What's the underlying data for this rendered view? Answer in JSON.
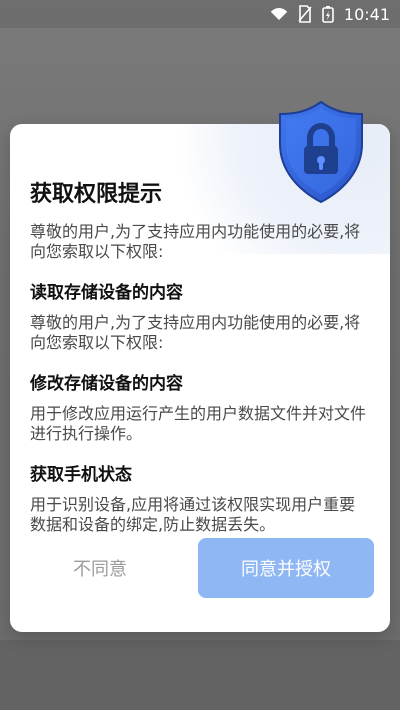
{
  "status_bar": {
    "time": "10:41",
    "icons": [
      "wifi-icon",
      "no-sim-icon",
      "battery-icon"
    ]
  },
  "dialog": {
    "title": "获取权限提示",
    "intro": "尊敬的用户,为了支持应用内功能使用的必要,将向您索取以下权限:",
    "permissions": [
      {
        "title": "读取存储设备的内容",
        "desc": "尊敬的用户,为了支持应用内功能使用的必要,将向您索取以下权限:"
      },
      {
        "title": "修改存储设备的内容",
        "desc": "用于修改应用运行产生的用户数据文件并对文件进行执行操作。"
      },
      {
        "title": "获取手机状态",
        "desc": "用于识别设备,应用将通过该权限实现用户重要数据和设备的绑定,防止数据丢失。"
      }
    ],
    "buttons": {
      "disagree": "不同意",
      "agree": "同意并授权"
    },
    "icon": "shield-lock-icon"
  },
  "colors": {
    "primary_button": "#8fb7f3",
    "shield_blue": "#2f62d9",
    "overlay": "#707070"
  }
}
